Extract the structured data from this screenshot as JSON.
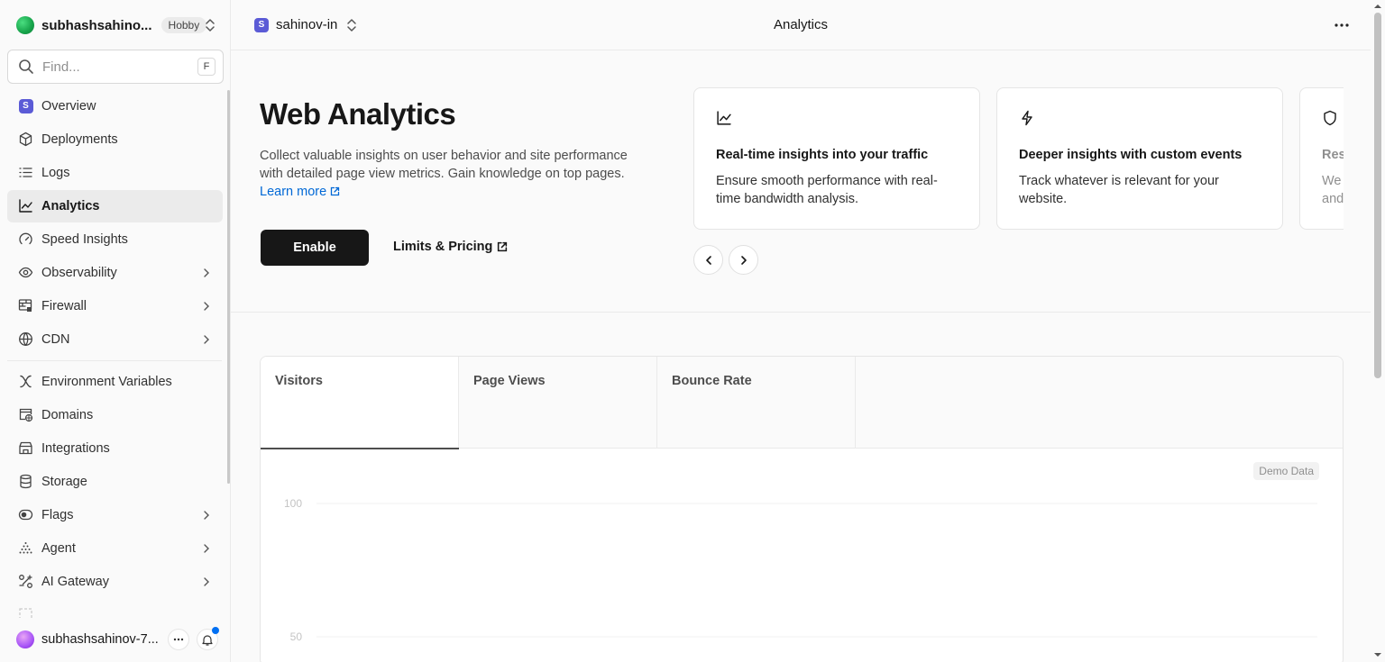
{
  "colors": {
    "accent": "#171717",
    "link": "#0068d6",
    "project_badge": "#5b5bd6",
    "active_bg": "#ebebeb"
  },
  "team": {
    "name": "subhashsahino...",
    "plan": "Hobby"
  },
  "search": {
    "placeholder": "Find...",
    "shortcut": "F"
  },
  "sidebar": {
    "items": [
      {
        "label": "Overview",
        "icon": "project-badge-icon"
      },
      {
        "label": "Deployments",
        "icon": "cube-icon"
      },
      {
        "label": "Logs",
        "icon": "list-icon"
      },
      {
        "label": "Analytics",
        "icon": "chart-line-icon",
        "active": true
      },
      {
        "label": "Speed Insights",
        "icon": "gauge-icon"
      },
      {
        "label": "Observability",
        "icon": "eye-icon",
        "has_submenu": true
      },
      {
        "label": "Firewall",
        "icon": "firewall-icon",
        "has_submenu": true
      },
      {
        "label": "CDN",
        "icon": "globe-icon",
        "has_submenu": true
      },
      {
        "label": "Environment Variables",
        "icon": "variable-icon"
      },
      {
        "label": "Domains",
        "icon": "domain-icon"
      },
      {
        "label": "Integrations",
        "icon": "store-icon"
      },
      {
        "label": "Storage",
        "icon": "database-icon"
      },
      {
        "label": "Flags",
        "icon": "toggle-icon",
        "has_submenu": true
      },
      {
        "label": "Agent",
        "icon": "agent-icon",
        "has_submenu": true
      },
      {
        "label": "AI Gateway",
        "icon": "gateway-icon",
        "has_submenu": true
      }
    ],
    "project_badge_letter": "S"
  },
  "user": {
    "name": "subhashsahinov-7..."
  },
  "topbar": {
    "project_letter": "S",
    "project_name": "sahinov-in",
    "title": "Analytics"
  },
  "hero": {
    "title": "Web Analytics",
    "description": "Collect valuable insights on user behavior and site performance with detailed page view metrics. Gain knowledge on top pages.",
    "learn_more": "Learn more",
    "enable_label": "Enable",
    "limits_label": "Limits & Pricing"
  },
  "cards": [
    {
      "icon": "chart-line-icon",
      "title": "Real-time insights into your traffic",
      "description": "Ensure smooth performance with real-time bandwidth analysis."
    },
    {
      "icon": "bolt-icon",
      "title": "Deeper insights with custom events",
      "description": "Track whatever is relevant for your website."
    },
    {
      "icon": "shield-icon",
      "title": "Res",
      "description": "We and"
    }
  ],
  "chart": {
    "tabs": [
      "Visitors",
      "Page Views",
      "Bounce Rate"
    ],
    "active_tab": "Visitors",
    "badge": "Demo Data"
  },
  "chart_data": {
    "type": "line",
    "title": "",
    "xlabel": "",
    "ylabel": "",
    "y_ticks": [
      100,
      50
    ],
    "grid": true,
    "series": []
  }
}
